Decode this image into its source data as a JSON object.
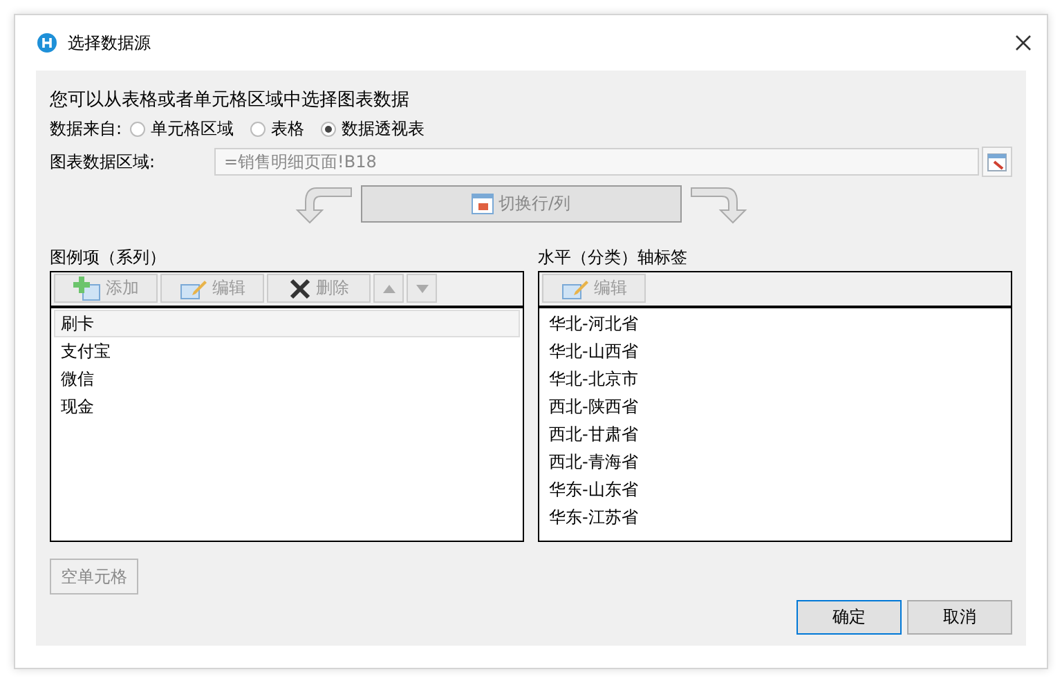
{
  "window": {
    "title": "选择数据源"
  },
  "intro": "您可以从表格或者单元格区域中选择图表数据",
  "source": {
    "label": "数据来自:",
    "options": [
      {
        "label": "单元格区域",
        "selected": false
      },
      {
        "label": "表格",
        "selected": false
      },
      {
        "label": "数据透视表",
        "selected": true
      }
    ]
  },
  "range": {
    "label": "图表数据区域:",
    "value": "=销售明细页面!B18",
    "disabled": true
  },
  "switch_button": {
    "label": "切换行/列",
    "disabled": true
  },
  "series": {
    "title": "图例项（系列）",
    "toolbar": [
      {
        "kind": "add",
        "label": "添加",
        "disabled": true
      },
      {
        "kind": "edit",
        "label": "编辑",
        "disabled": true
      },
      {
        "kind": "delete",
        "label": "删除",
        "disabled": true
      },
      {
        "kind": "up",
        "disabled": true
      },
      {
        "kind": "down",
        "disabled": true
      }
    ],
    "items": [
      {
        "label": "刷卡",
        "selected": true
      },
      {
        "label": "支付宝",
        "selected": false
      },
      {
        "label": "微信",
        "selected": false
      },
      {
        "label": "现金",
        "selected": false
      }
    ]
  },
  "categories": {
    "title": "水平（分类）轴标签",
    "toolbar": [
      {
        "kind": "edit",
        "label": "编辑",
        "disabled": true
      }
    ],
    "items": [
      {
        "label": "华北-河北省",
        "selected": false
      },
      {
        "label": "华北-山西省",
        "selected": false
      },
      {
        "label": "华北-北京市",
        "selected": false
      },
      {
        "label": "西北-陕西省",
        "selected": false
      },
      {
        "label": "西北-甘肃省",
        "selected": false
      },
      {
        "label": "西北-青海省",
        "selected": false
      },
      {
        "label": "华东-山东省",
        "selected": false
      },
      {
        "label": "华东-江苏省",
        "selected": false
      }
    ]
  },
  "empty_cells_button": {
    "label": "空单元格",
    "disabled": true
  },
  "buttons": [
    {
      "label": "确定",
      "default": true
    },
    {
      "label": "取消",
      "default": false
    }
  ]
}
